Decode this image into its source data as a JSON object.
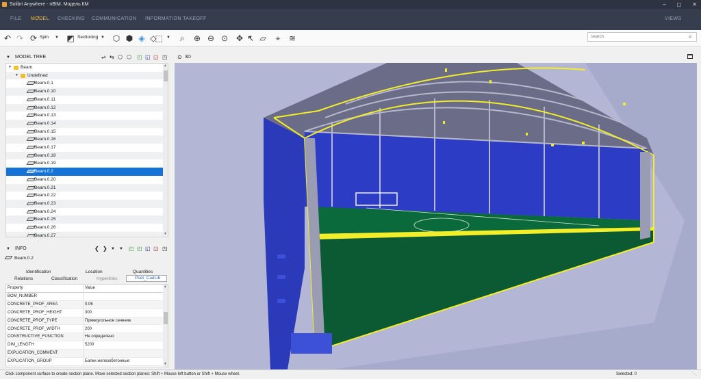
{
  "window": {
    "title": "Solibri Anywhere - nBIM. Модель КМ",
    "controls": [
      "–",
      "◻",
      "✕"
    ]
  },
  "menu": {
    "tabs": [
      "FILE",
      "MODEL",
      "CHECKING",
      "COMMUNICATION",
      "INFORMATION TAKEOFF"
    ],
    "active": "MODEL",
    "views_label": "VIEWS"
  },
  "toolbar": {
    "spin_label": "Spin",
    "sectioning_label": "Sectioning",
    "search_placeholder": "Search"
  },
  "model_tree": {
    "header": "MODEL TREE",
    "root": "Beam",
    "group": "Undefined",
    "items": [
      "Beam.0.1",
      "Beam.0.10",
      "Beam.0.11",
      "Beam.0.12",
      "Beam.0.13",
      "Beam.0.14",
      "Beam.0.15",
      "Beam.0.16",
      "Beam.0.17",
      "Beam.0.18",
      "Beam.0.19",
      "Beam.0.2",
      "Beam.0.20",
      "Beam.0.21",
      "Beam.0.22",
      "Beam.0.23",
      "Beam.0.24",
      "Beam.0.25",
      "Beam.0.26",
      "Beam.0.27"
    ],
    "selected": "Beam.0.2"
  },
  "info": {
    "header": "INFO",
    "selected_name": "Beam.0.2",
    "tabs_row1": [
      "Identification",
      "Location",
      "Quantities"
    ],
    "tabs_row2": [
      "Relations",
      "Classification",
      "Hyperlinks",
      "Pset_CadLib"
    ],
    "active_tab": "Pset_CadLib",
    "columns": [
      "Property",
      "Value"
    ],
    "rows": [
      [
        "BOM_NUMBER",
        ""
      ],
      [
        "CONCRETE_PROF_AREA",
        "0.06"
      ],
      [
        "CONCRETE_PROF_HEIGHT",
        "300"
      ],
      [
        "CONCRETE_PROF_TYPE",
        "Прямоугольное сечение"
      ],
      [
        "CONCRETE_PROF_WIDTH",
        "200"
      ],
      [
        "CONSTRUCTIVE_FUNCTION",
        "Не определено"
      ],
      [
        "DIM_LENGTH",
        "5200"
      ],
      [
        "EXPLICATION_COMMENT",
        ""
      ],
      [
        "EXPLICATION_GROUP",
        "Балки железобетонные"
      ]
    ]
  },
  "view": {
    "label": "3D"
  },
  "status": {
    "message": "Click component surface to create section plane. Move selected section planes: Shift + Mouse left button or Shift + Mouse wheel.",
    "selected": "Selected: 0"
  },
  "colors": {
    "accent": "#f0c040",
    "selection": "#1473d6",
    "viewport_bg": "#b3b6d4",
    "titlebar": "#2d3340",
    "menubar": "#363d4c"
  }
}
